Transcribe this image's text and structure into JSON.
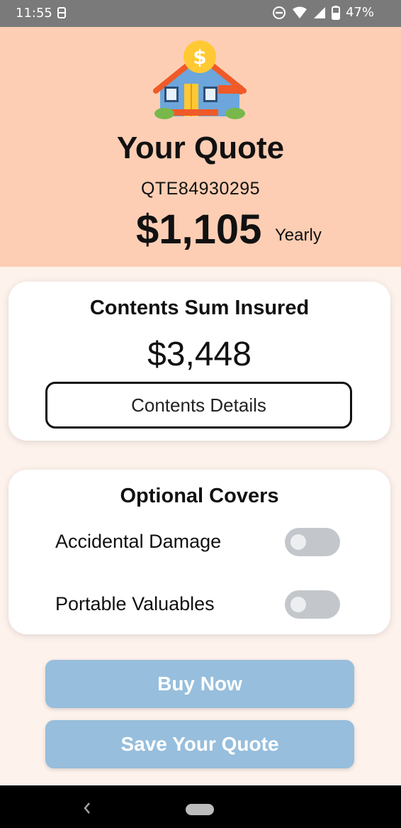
{
  "status_bar": {
    "time": "11:55",
    "battery": "47%"
  },
  "header": {
    "title": "Your Quote",
    "quote_id": "QTE84930295",
    "price": "$1,105",
    "period": "Yearly"
  },
  "contents": {
    "title": "Contents Sum Insured",
    "value": "$3,448",
    "details_button": "Contents Details"
  },
  "optional_covers": {
    "title": "Optional Covers",
    "items": [
      {
        "label": "Accidental Damage",
        "enabled": false
      },
      {
        "label": "Portable Valuables",
        "enabled": false
      }
    ]
  },
  "actions": {
    "buy_label": "Buy Now",
    "save_label": "Save Your Quote"
  },
  "colors": {
    "header_bg": "#fdceb4",
    "page_bg": "#fdf2ec",
    "button_bg": "#97bedc",
    "toggle_off": "#c3c7cc"
  }
}
